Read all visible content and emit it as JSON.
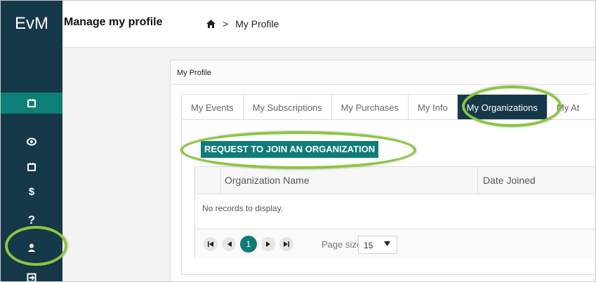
{
  "app": {
    "logo": "EvM"
  },
  "header": {
    "title": "Manage my profile",
    "breadcrumb": {
      "separator": ">",
      "current": "My Profile"
    }
  },
  "sidebar": {
    "items": [
      {
        "icon": "calendar-icon",
        "active": true
      },
      {
        "icon": "eye-icon",
        "active": false
      },
      {
        "icon": "calendar-icon",
        "active": false
      },
      {
        "icon": "dollar-icon",
        "active": false
      },
      {
        "icon": "question-icon",
        "active": false
      },
      {
        "icon": "user-icon",
        "active": false,
        "highlighted": true
      },
      {
        "icon": "logout-icon",
        "active": false
      }
    ]
  },
  "card": {
    "title": "My Profile",
    "tabs": [
      {
        "label": "My Events"
      },
      {
        "label": "My Subscriptions"
      },
      {
        "label": "My Purchases"
      },
      {
        "label": "My Info"
      },
      {
        "label": "My Organizations",
        "selected": true
      },
      {
        "label": "My At"
      }
    ],
    "join_button": "REQUEST TO JOIN AN ORGANIZATION",
    "table": {
      "columns": [
        "Organization Name",
        "Date Joined"
      ],
      "empty_text": "No records to display."
    },
    "pager": {
      "current_page": "1",
      "page_size_label": "Page size:",
      "page_size_value": "15"
    }
  },
  "colors": {
    "sidebar_bg": "#16394a",
    "accent_teal": "#0f7c78",
    "highlight_green": "#8cc63f"
  }
}
